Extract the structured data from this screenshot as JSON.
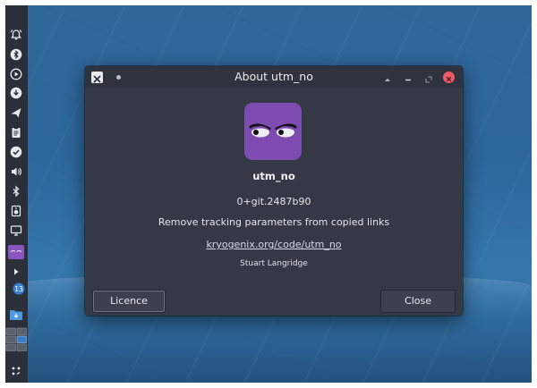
{
  "dialog": {
    "title": "About utm_no",
    "app_name": "utm_no",
    "version": "0+git.2487b90",
    "description": "Remove tracking parameters from copied links",
    "link": "kryogenix.org/code/utm_no",
    "author": "Stuart Langridge",
    "buttons": {
      "licence": "Licence",
      "close": "Close"
    }
  },
  "panel": {
    "icons": [
      "bell-icon",
      "bluetooth-circle-icon",
      "play-circle-icon",
      "download-circle-icon",
      "send-icon",
      "clipboard-icon",
      "check-circle-icon",
      "volume-icon",
      "bluetooth-icon",
      "speaker-icon",
      "display-icon",
      "utm-no-tray-icon",
      "arrow-right-icon",
      "update-badge-icon",
      "folder-download-icon",
      "workspace-switcher-icon",
      "app-launcher-icon"
    ],
    "update_count": "13"
  },
  "colors": {
    "app_icon": "#7e4bb0",
    "close_red": "#ee5a68",
    "dialog_bg": "#353945"
  }
}
